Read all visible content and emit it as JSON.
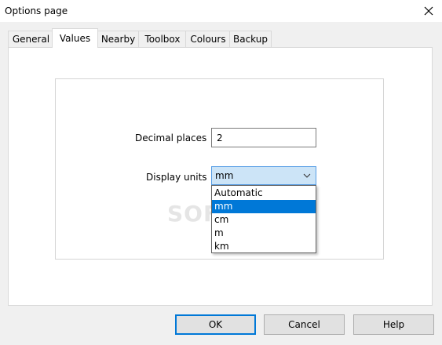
{
  "window": {
    "title": "Options page"
  },
  "tabs": [
    {
      "label": "General"
    },
    {
      "label": "Values",
      "active": true
    },
    {
      "label": "Nearby"
    },
    {
      "label": "Toolbox"
    },
    {
      "label": "Colours"
    },
    {
      "label": "Backup"
    }
  ],
  "values": {
    "decimal_places_label": "Decimal places",
    "decimal_places_value": "2",
    "display_units_label": "Display units",
    "display_units_value": "mm",
    "unit_options": [
      "Automatic",
      "mm",
      "cm",
      "m",
      "km"
    ],
    "highlighted_option": "mm"
  },
  "watermark": "SOFTPEDIA",
  "buttons": {
    "ok": "OK",
    "cancel": "Cancel",
    "help": "Help"
  },
  "colors": {
    "accent": "#0078d7",
    "combo_bg": "#cce4f7",
    "combo_border": "#569de5"
  },
  "icons": {
    "close": "close-icon",
    "dropdown": "chevron-down-icon"
  }
}
